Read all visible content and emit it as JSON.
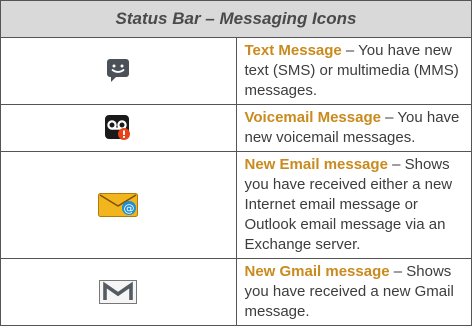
{
  "table": {
    "header": "Status Bar – Messaging Icons",
    "rows": [
      {
        "icon": "text-message-icon",
        "title": "Text Message",
        "desc": " – You have new text (SMS) or multimedia (MMS) messages."
      },
      {
        "icon": "voicemail-icon",
        "title": "Voicemail Message",
        "desc": " – You have new voicemail messages."
      },
      {
        "icon": "email-icon",
        "title": "New Email message",
        "desc": " – Shows you have received either a new Internet email message or Outlook email message via an Exchange server."
      },
      {
        "icon": "gmail-icon",
        "title": "New Gmail message",
        "desc": " – Shows you have received a new Gmail message."
      }
    ]
  },
  "colors": {
    "title_accent": "#c98a1e",
    "header_bg": "#d9d9d9",
    "header_text": "#4a4a4a"
  }
}
